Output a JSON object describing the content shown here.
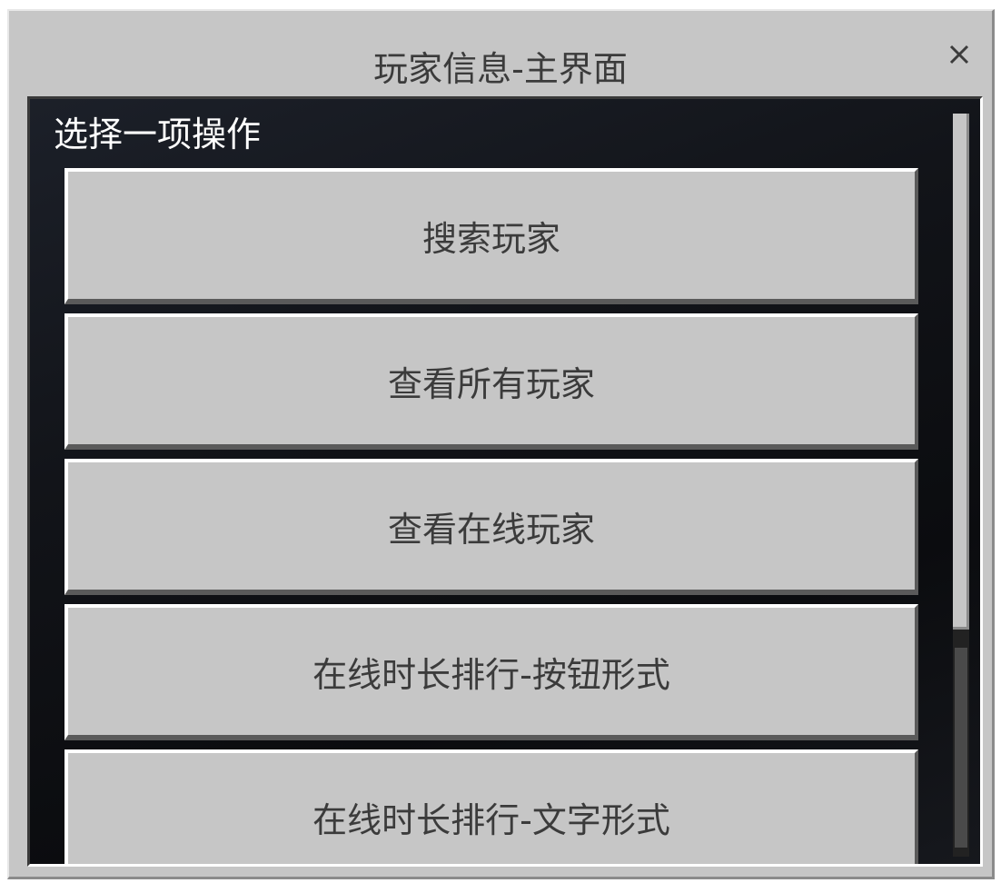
{
  "dialog": {
    "title": "玩家信息-主界面"
  },
  "panel": {
    "label": "选择一项操作",
    "buttons": [
      {
        "label": "搜索玩家"
      },
      {
        "label": "查看所有玩家"
      },
      {
        "label": "查看在线玩家"
      },
      {
        "label": "在线时长排行-按钮形式"
      },
      {
        "label": "在线时长排行-文字形式"
      }
    ]
  },
  "icons": {
    "close": "close-icon"
  }
}
